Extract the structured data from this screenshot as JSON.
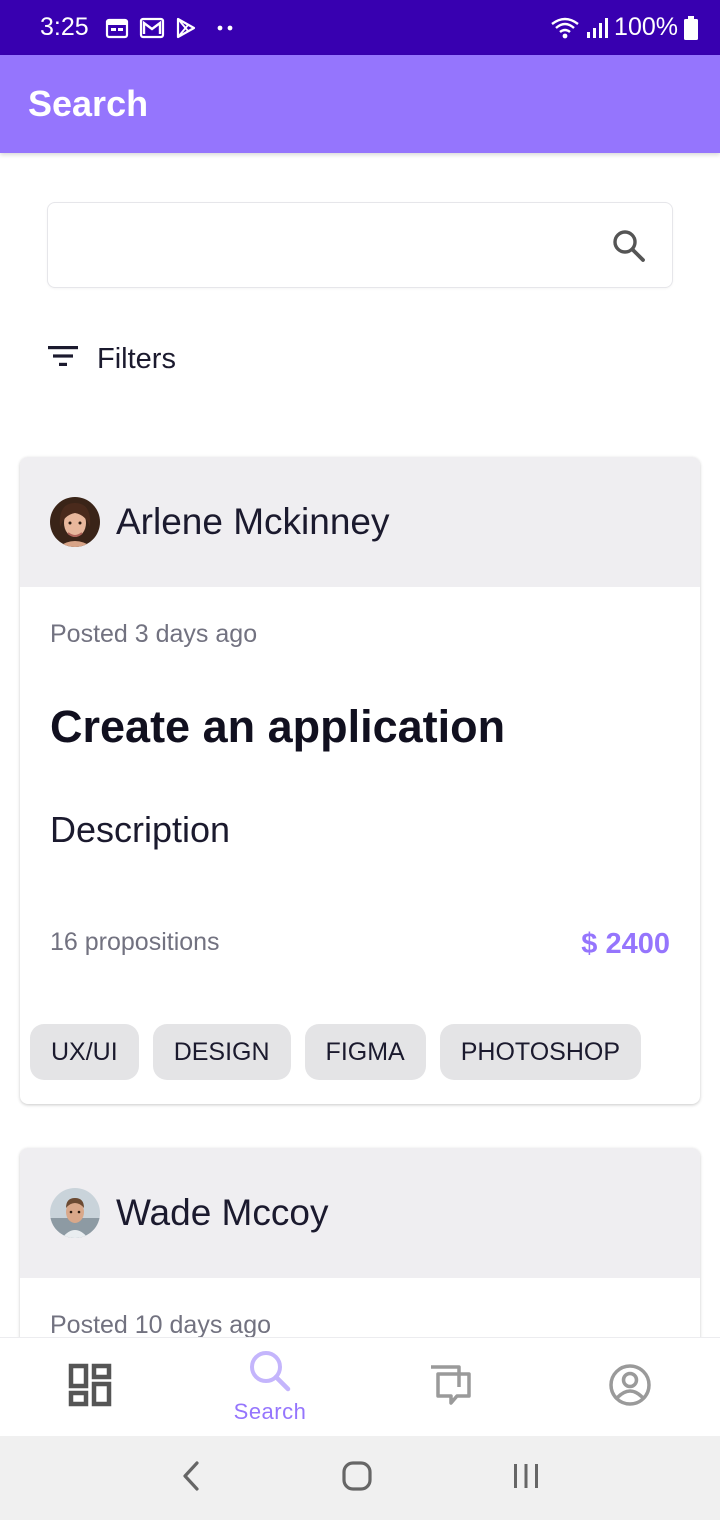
{
  "status_bar": {
    "time": "3:25",
    "battery": "100%",
    "notification_icons": [
      "calendar-icon",
      "gmail-icon",
      "play-store-icon",
      "more-dots-icon"
    ],
    "right_icons": [
      "wifi-icon",
      "signal-icon",
      "battery-icon"
    ]
  },
  "app_bar": {
    "title": "Search"
  },
  "search": {
    "value": "",
    "placeholder": "",
    "icon": "search-icon"
  },
  "filters": {
    "label": "Filters",
    "icon": "filter-icon"
  },
  "posts": [
    {
      "author": "Arlene Mckinney",
      "posted": "Posted 3 days ago",
      "title": "Create an application",
      "description": "Description",
      "propositions": "16 propositions",
      "price": "$ 2400",
      "tags": [
        "UX/UI",
        "DESIGN",
        "FIGMA",
        "PHOTOSHOP"
      ]
    },
    {
      "author": "Wade Mccoy",
      "posted": "Posted 10 days ago"
    }
  ],
  "bottom_nav": {
    "items": [
      {
        "icon": "dashboard-icon",
        "label": ""
      },
      {
        "icon": "search-icon",
        "label": "Search"
      },
      {
        "icon": "chat-icon",
        "label": ""
      },
      {
        "icon": "account-icon",
        "label": ""
      }
    ],
    "active_index": 1
  },
  "colors": {
    "status_bar": "#3800b0",
    "app_bar": "#9575fd",
    "accent": "#9575fd",
    "card_header": "#efeef1",
    "tag_bg": "#e4e4e6"
  }
}
